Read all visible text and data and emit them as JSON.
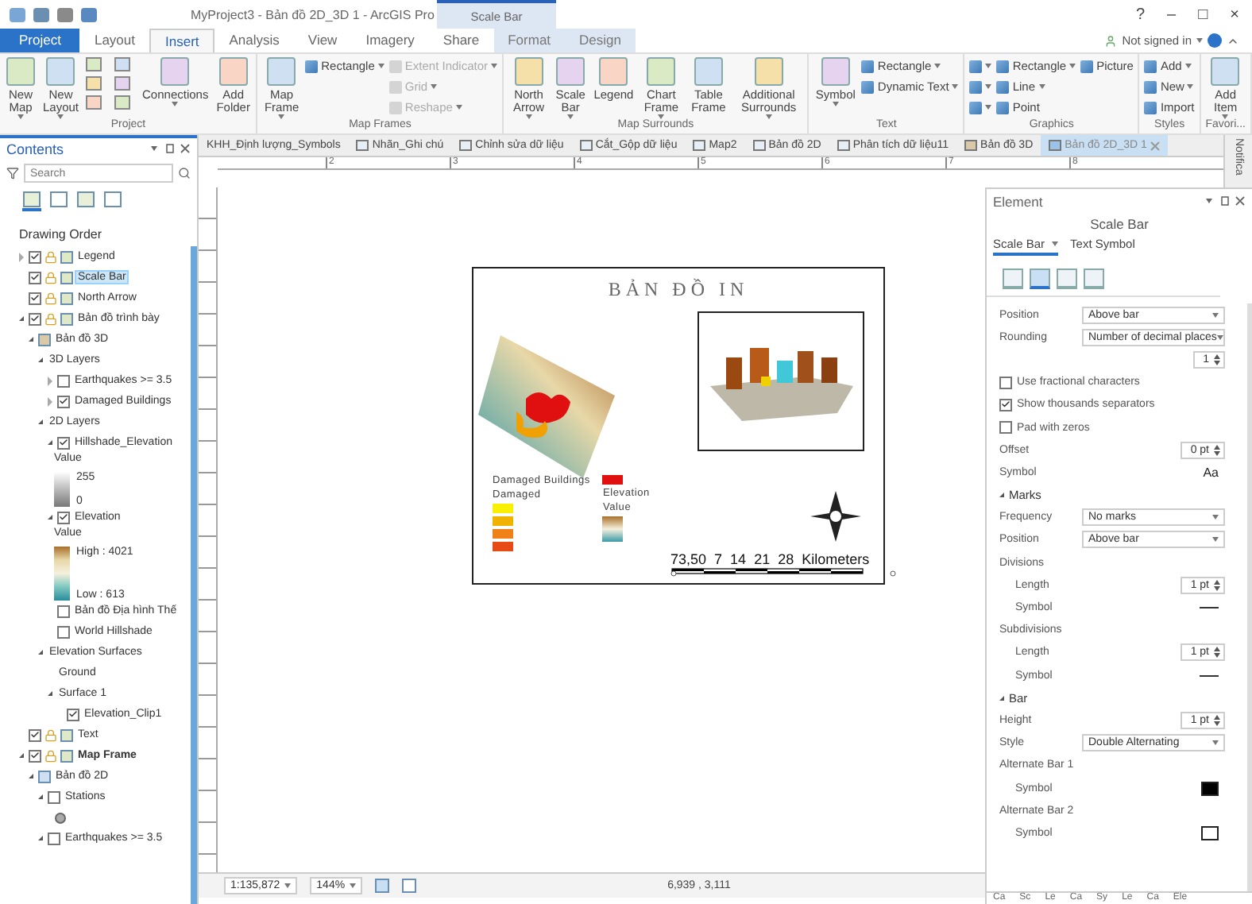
{
  "title_bar": {
    "title": "MyProject3 - Bản đồ 2D_3D 1 - ArcGIS Pro",
    "context": "Scale Bar",
    "controls": [
      "?",
      "–",
      "□",
      "×"
    ]
  },
  "tabs": [
    {
      "label": "Project",
      "kind": "file",
      "selected": false
    },
    {
      "label": "Layout",
      "kind": "core",
      "selected": false
    },
    {
      "label": "Insert",
      "kind": "core",
      "selected": true
    },
    {
      "label": "Analysis",
      "kind": "core",
      "selected": false
    },
    {
      "label": "View",
      "kind": "core",
      "selected": false
    },
    {
      "label": "Imagery",
      "kind": "core",
      "selected": false
    },
    {
      "label": "Share",
      "kind": "core",
      "selected": false
    },
    {
      "label": "Format",
      "kind": "contextual",
      "selected": false
    },
    {
      "label": "Design",
      "kind": "contextual",
      "selected": false
    }
  ],
  "account": {
    "label": "Not signed in"
  },
  "ribbon": [
    {
      "label": "Project",
      "items": [
        {
          "kind": "large",
          "label": "New Map",
          "dropdown": true
        },
        {
          "kind": "large",
          "label": "New Layout",
          "dropdown": true
        },
        {
          "kind": "icon_grid"
        },
        {
          "kind": "large",
          "label": "Connections",
          "dropdown": true
        },
        {
          "kind": "large",
          "label": "Add Folder",
          "dropdown": false
        }
      ]
    },
    {
      "label": "Map Frames",
      "items": [
        {
          "kind": "large",
          "label": "Map Frame",
          "dropdown": true
        },
        {
          "kind": "rows",
          "rows": [
            [
              {
                "label": "Rectangle",
                "dropdown": true,
                "disabled": false
              }
            ]
          ]
        },
        {
          "kind": "rows",
          "rows": [
            [
              {
                "label": "Extent Indicator",
                "dropdown": true,
                "disabled": true
              }
            ],
            [
              {
                "label": "Grid",
                "dropdown": true,
                "disabled": true
              }
            ],
            [
              {
                "label": "Reshape",
                "dropdown": true,
                "disabled": true
              }
            ]
          ]
        }
      ]
    },
    {
      "label": "Map Surrounds",
      "items": [
        {
          "kind": "large",
          "label": "North Arrow",
          "dropdown": true
        },
        {
          "kind": "large",
          "label": "Scale Bar",
          "dropdown": true
        },
        {
          "kind": "large",
          "label": "Legend",
          "dropdown": false
        },
        {
          "kind": "large",
          "label": "Chart Frame",
          "dropdown": true
        },
        {
          "kind": "large",
          "label": "Table Frame",
          "dropdown": false
        },
        {
          "kind": "large",
          "label": "Additional Surrounds",
          "dropdown": true
        }
      ]
    },
    {
      "label": "Text",
      "items": [
        {
          "kind": "large",
          "label": "Symbol",
          "dropdown": true
        },
        {
          "kind": "rows",
          "rows": [
            [
              {
                "label": "Rectangle",
                "dropdown": true,
                "disabled": false
              }
            ],
            [
              {
                "label": "Dynamic Text",
                "dropdown": true,
                "disabled": false
              }
            ]
          ]
        }
      ]
    },
    {
      "label": "Graphics",
      "items": [
        {
          "kind": "rows",
          "rows": [
            [
              {
                "dropdown": true,
                "disabled": false
              },
              {
                "label": "Rectangle",
                "dropdown": true,
                "disabled": false
              },
              {
                "label": "Picture",
                "dropdown": false,
                "disabled": false
              }
            ],
            [
              {
                "dropdown": true,
                "disabled": false
              },
              {
                "label": "Line",
                "dropdown": true,
                "disabled": false
              }
            ],
            [
              {
                "dropdown": true,
                "disabled": false
              },
              {
                "label": "Point",
                "dropdown": false,
                "disabled": false
              }
            ]
          ]
        }
      ]
    },
    {
      "label": "Styles",
      "items": [
        {
          "kind": "rows",
          "rows": [
            [
              {
                "label": "Add",
                "dropdown": true,
                "disabled": false
              }
            ],
            [
              {
                "label": "New",
                "dropdown": true,
                "disabled": false
              }
            ],
            [
              {
                "label": "Import",
                "dropdown": false,
                "disabled": false
              }
            ]
          ]
        }
      ]
    },
    {
      "label": "Favori...",
      "items": [
        {
          "kind": "large",
          "label": "Add Item",
          "dropdown": true
        }
      ]
    }
  ],
  "contents": {
    "title": "Contents",
    "search": {
      "placeholder": "Search"
    },
    "view_tabs": [
      {
        "selected": true
      },
      {
        "selected": false
      },
      {
        "selected": false
      },
      {
        "selected": false
      }
    ],
    "heading": "Drawing Order",
    "items": [
      {
        "kind": "element",
        "label": "Legend",
        "checked": true,
        "expanded": false,
        "selected": false
      },
      {
        "kind": "element",
        "label": "Scale Bar",
        "checked": true,
        "selected": true
      },
      {
        "kind": "element",
        "label": "North Arrow",
        "checked": true,
        "selected": false
      },
      {
        "kind": "element",
        "label": "Bản đồ trình bày",
        "checked": true,
        "expanded": true,
        "selected": false,
        "children": [
          {
            "kind": "scene",
            "label": "Bản đồ 3D",
            "expanded": true,
            "children": [
              {
                "label": "3D Layers",
                "expanded": true,
                "children": [
                  {
                    "label": "Earthquakes >= 3.5",
                    "checked": false,
                    "expanded": false
                  },
                  {
                    "label": "Damaged Buildings",
                    "checked": true,
                    "expanded": false
                  }
                ]
              },
              {
                "label": "2D Layers",
                "expanded": true,
                "children": [
                  {
                    "label": "Hillshade_Elevation",
                    "checked": true,
                    "expanded": true,
                    "children": [
                      {
                        "kind": "gray_ramp",
                        "title": "Value",
                        "high": "255",
                        "low": "0"
                      }
                    ]
                  },
                  {
                    "label": "Elevation",
                    "checked": true,
                    "expanded": true,
                    "children": [
                      {
                        "kind": "color_ramp",
                        "title": "Value",
                        "high": "High : 4021",
                        "low": "Low : 613"
                      }
                    ]
                  },
                  {
                    "label": "Bản đồ Địa hình Thế",
                    "checked": false
                  },
                  {
                    "label": "World Hillshade",
                    "checked": false
                  }
                ]
              },
              {
                "label": "Elevation Surfaces",
                "expanded": true,
                "children": [
                  {
                    "label": "Ground"
                  },
                  {
                    "label": "Surface 1",
                    "expanded": true,
                    "children": [
                      {
                        "label": "Elevation_Clip1",
                        "checked": true
                      }
                    ]
                  }
                ]
              }
            ]
          }
        ]
      },
      {
        "kind": "element",
        "label": "Text",
        "checked": true,
        "selected": false
      },
      {
        "kind": "element",
        "label": "Map Frame",
        "checked": true,
        "expanded": true,
        "active": true,
        "selected": false,
        "children": [
          {
            "kind": "map",
            "label": "Bản đồ 2D",
            "expanded": true,
            "children": [
              {
                "label": "Stations",
                "checked": false,
                "expanded": true,
                "children": [
                  {
                    "kind": "symbol"
                  }
                ]
              },
              {
                "label": "Earthquakes >= 3.5",
                "checked": false,
                "expanded": true
              }
            ]
          }
        ]
      }
    ]
  },
  "doc_tabs": [
    {
      "label": "KHH_Định lượng_Symbols",
      "kind": "plain",
      "selected": false
    },
    {
      "label": "Nhãn_Ghi chú",
      "kind": "map",
      "selected": false
    },
    {
      "label": "Chỉnh sửa dữ liệu",
      "kind": "map",
      "selected": false
    },
    {
      "label": "Cắt_Gộp dữ liệu",
      "kind": "map",
      "selected": false
    },
    {
      "label": "Map2",
      "kind": "map",
      "selected": false
    },
    {
      "label": "Bản đồ 2D",
      "kind": "map",
      "selected": false
    },
    {
      "label": "Phân tích dữ liệu11",
      "kind": "map",
      "selected": false
    },
    {
      "label": "Bản đồ 3D",
      "kind": "scene",
      "selected": false
    },
    {
      "label": "Bản đồ 2D_3D 1",
      "kind": "layout",
      "selected": true
    }
  ],
  "notifications": {
    "label": "Notifica"
  },
  "ruler": {
    "labels": [
      "2",
      "3",
      "4",
      "5",
      "6",
      "7",
      "8"
    ]
  },
  "layout": {
    "title": "BẢN ĐỒ IN",
    "legend": {
      "title": "Damaged Buildings",
      "subtitle": "Damaged",
      "classes": [
        {
          "color": "#f8f000"
        },
        {
          "color": "#f0b400"
        },
        {
          "color": "#f08018"
        },
        {
          "color": "#e84a14"
        },
        {
          "color": "#e01010"
        }
      ],
      "elevation_title": "Elevation",
      "elevation_subtitle": "Value"
    },
    "scale_bar": {
      "labels": [
        "73,50",
        "7",
        "14",
        "21",
        "28"
      ],
      "units": "Kilometers"
    }
  },
  "status_bar": {
    "scale": "1:135,872",
    "zoom": "144%",
    "coordinates": "6,939 , 3,111"
  },
  "element": {
    "title": "Element",
    "subject": "Scale Bar",
    "tabs": [
      {
        "label": "Scale Bar",
        "selected": true,
        "dropdown": true
      },
      {
        "label": "Text Symbol",
        "selected": false,
        "dropdown": false
      }
    ],
    "icon_tabs": [
      {
        "selected": false
      },
      {
        "selected": true
      },
      {
        "selected": false
      },
      {
        "selected": false
      }
    ],
    "rows": [
      {
        "kind": "dropdown",
        "label": "Position",
        "value": "Above bar"
      },
      {
        "kind": "dropdown",
        "label": "Rounding",
        "value": "Number of decimal places"
      },
      {
        "kind": "spinner",
        "value": "1"
      },
      {
        "kind": "checkbox",
        "label": "Use fractional characters",
        "checked": false
      },
      {
        "kind": "checkbox",
        "label": "Show thousands separators",
        "checked": true
      },
      {
        "kind": "checkbox",
        "label": "Pad with zeros",
        "checked": false
      },
      {
        "kind": "spinner",
        "label": "Offset",
        "value": "0 pt"
      },
      {
        "kind": "text_symbol",
        "label": "Symbol",
        "sample": "Aa"
      },
      {
        "kind": "section",
        "label": "Marks",
        "expanded": true
      },
      {
        "kind": "dropdown",
        "label": "Frequency",
        "value": "No marks"
      },
      {
        "kind": "dropdown",
        "label": "Position",
        "value": "Above bar"
      },
      {
        "kind": "subheading",
        "label": "Divisions"
      },
      {
        "kind": "spinner",
        "label": "Length",
        "value": "1 pt",
        "indent": true
      },
      {
        "kind": "line_symbol",
        "label": "Symbol",
        "indent": true
      },
      {
        "kind": "subheading",
        "label": "Subdivisions"
      },
      {
        "kind": "spinner",
        "label": "Length",
        "value": "1 pt",
        "indent": true
      },
      {
        "kind": "line_symbol",
        "label": "Symbol",
        "indent": true
      },
      {
        "kind": "section",
        "label": "Bar",
        "expanded": true
      },
      {
        "kind": "spinner",
        "label": "Height",
        "value": "1 pt"
      },
      {
        "kind": "dropdown",
        "label": "Style",
        "value": "Double Alternating"
      },
      {
        "kind": "subheading",
        "label": "Alternate Bar 1"
      },
      {
        "kind": "fill_symbol",
        "label": "Symbol",
        "color": "#000000",
        "indent": true
      },
      {
        "kind": "subheading",
        "label": "Alternate Bar 2"
      },
      {
        "kind": "fill_symbol",
        "label": "Symbol",
        "color": "#ffffff",
        "indent": true
      }
    ],
    "bottom_tabs": [
      "Ca",
      "Sc",
      "Le",
      "Ca",
      "Sy",
      "Le",
      "Ca",
      "Ele"
    ]
  }
}
